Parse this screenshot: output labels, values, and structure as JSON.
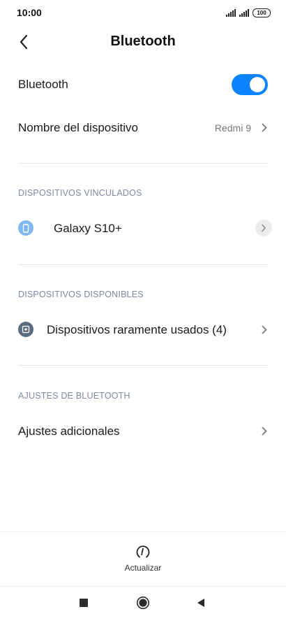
{
  "status_bar": {
    "time": "10:00",
    "battery": "100",
    "signal_icons": [
      "signal-icon",
      "signal-icon"
    ]
  },
  "header": {
    "title": "Bluetooth",
    "back_icon": "back-arrow-icon"
  },
  "bluetooth_toggle": {
    "label": "Bluetooth",
    "state": "on",
    "accent_color": "#0d84ff"
  },
  "device_name": {
    "label": "Nombre del dispositivo",
    "value": "Redmi 9"
  },
  "paired_section": {
    "header": "DISPOSITIVOS VINCULADOS",
    "devices": [
      {
        "name": "Galaxy S10+",
        "icon": "phone-icon",
        "icon_color": "#7fb8f2"
      }
    ]
  },
  "available_section": {
    "header": "DISPOSITIVOS DISPONIBLES",
    "items": [
      {
        "name": "Dispositivos raramente usados (4)",
        "icon": "device-box-icon",
        "icon_color": "#5b6b80"
      }
    ]
  },
  "settings_section": {
    "header": "AJUSTES DE BLUETOOTH",
    "items": [
      {
        "name": "Ajustes adicionales"
      }
    ]
  },
  "bottom_action": {
    "label": "Actualizar",
    "icon": "refresh-icon"
  },
  "nav_bar": {
    "buttons": [
      "recents-square-icon",
      "home-circle-icon",
      "back-triangle-icon"
    ]
  }
}
